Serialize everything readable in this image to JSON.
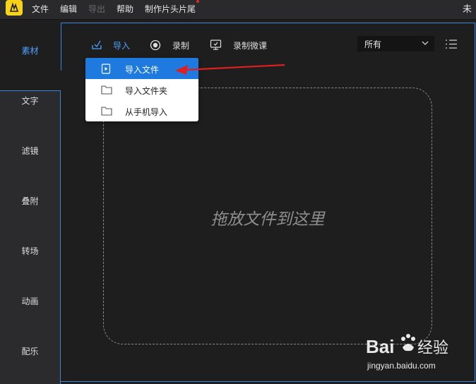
{
  "menubar": {
    "items": [
      {
        "label": "文件",
        "enabled": true
      },
      {
        "label": "编辑",
        "enabled": true
      },
      {
        "label": "导出",
        "enabled": false
      },
      {
        "label": "帮助",
        "enabled": true
      },
      {
        "label": "制作片头片尾",
        "enabled": true
      }
    ],
    "title_partial": "未"
  },
  "sidebar": {
    "items": [
      {
        "label": "素材",
        "active": true
      },
      {
        "label": "文字"
      },
      {
        "label": "滤镜"
      },
      {
        "label": "叠附"
      },
      {
        "label": "转场"
      },
      {
        "label": "动画"
      },
      {
        "label": "配乐"
      }
    ]
  },
  "toolbar": {
    "import_label": "导入",
    "record_label": "录制",
    "record_lesson_label": "录制微课",
    "filter_value": "所有"
  },
  "import_menu": {
    "items": [
      {
        "label": "导入文件",
        "icon": "file-play-icon",
        "highlighted": true
      },
      {
        "label": "导入文件夹",
        "icon": "folder-icon"
      },
      {
        "label": "从手机导入",
        "icon": "folder-icon"
      }
    ]
  },
  "dropzone": {
    "text": "拖放文件到这里"
  },
  "watermark": {
    "brand": "Bai",
    "brand2": "经验",
    "url": "jingyan.baidu.com"
  },
  "colors": {
    "accent": "#3a86d8",
    "highlight": "#1f7ae0",
    "annotation": "#e02020",
    "logo": "#f7d21b"
  }
}
